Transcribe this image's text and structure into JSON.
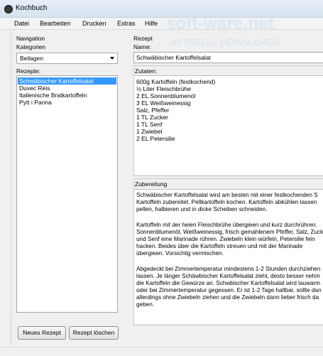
{
  "window": {
    "title": "Kochbuch"
  },
  "menu": [
    "Datei",
    "Bearbeiten",
    "Drucken",
    "Extras",
    "Hilfe"
  ],
  "watermark": {
    "main": "soft-ware.net",
    "sub": "AKTUELLE DOWNLOADS"
  },
  "navigation": {
    "heading": "Navigation",
    "categories_label": "Kategorien",
    "category_selected": "Beilagen",
    "recipes_label": "Rezepte:",
    "recipes": [
      "Schwäbischer Kartoffelsalat",
      "Duvec Reis",
      "Italienische Bratkartoffeln",
      "Pytt i Panna"
    ],
    "new_button": "Neues Rezept",
    "delete_button": "Rezept löschen"
  },
  "recipe": {
    "heading": "Rezept",
    "name_label": "Name:",
    "name_value": "Schwäbischer Kartoffelsalat",
    "ingredients_label": "Zutaten:",
    "ingredients": [
      "600g Kartoffeln (festkochend)",
      "½ Liter Fleischbrühe",
      "2 EL Sonnenblumenöl",
      "3 EL Weißweinessig",
      "Salz, Pfeffer",
      "1 TL Zucker",
      "1 TL Senf",
      "1 Zwiebel",
      "2 EL Petersilie"
    ],
    "preparation_label": "Zubereitung",
    "preparation_lines": [
      "Schwäbischer Kartoffelsalat wird am besten mit einer festkochenden S",
      "Kartoffeln zubereitet. Pellkartoffeln kochen. Kartoffeln abkühlen lassen",
      "pellen, halbieren und in dicke Scheiben schneiden.",
      "",
      "Kartoffeln mit der heien Fleischbrühe übergieen und kurz durchrühren.",
      "Sonnenblumenöl, Weißweinessig, frisch gemahlenem Pfeffer, Salz, Zuck",
      "und Senf eine Marinade rühren. Zwiebeln klein würfeln, Petersilie fein",
      "hacken. Beides über die Kartoffeln streuen und mit der Marinade",
      "übergieen. Vorsichtig vermischen.",
      "",
      "Abgedeckt bei Zimmertemperatur mindestens 1-2 Stunden durchziehen",
      "lassen. Je länger Schäwbischer Kartoffelsalat zieht, desto besser nehm",
      "die Kartoffeln die Gewürze an. Schwbischer Kartoffelsalat wird lauwarm",
      "oder bei Zimmertemperatur gegessen. Er ist 1-2 Tage haltbar, sollte dan",
      "allerdings ohne Zwiebeln ziehen und die Zwiebeln dann lieber frisch da",
      "geben."
    ]
  }
}
